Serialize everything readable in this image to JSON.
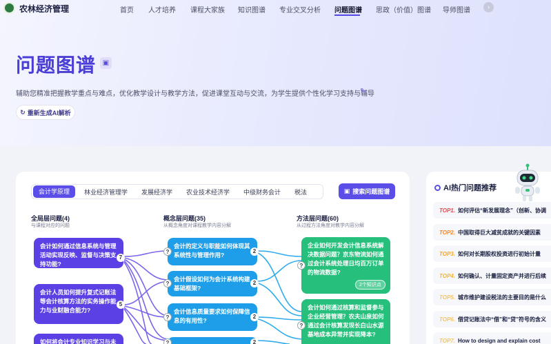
{
  "app": {
    "brand": "农林经济管理"
  },
  "nav": {
    "items": [
      "首页",
      "人才培养",
      "课程大家族",
      "知识图谱",
      "专业交叉分析",
      "问题图谱",
      "思政（价值）图谱",
      "导师图谱"
    ],
    "active": "问题图谱",
    "more_icon": "›"
  },
  "hero": {
    "title": "问题图谱",
    "subtitle": "辅助您精准把握教学重点与难点，优化教学设计与教学方法，促进课堂互动与交流，为学生提供个性化学习支持与辅导",
    "regen_label": "重新生成AI解析"
  },
  "tabs": {
    "items": [
      "会计学原理",
      "林业经济管理学",
      "发展经济学",
      "农业技术经济学",
      "中级财务会计",
      "税法"
    ],
    "active": "会计学原理",
    "more": "›"
  },
  "search_button": "搜索问题图谱",
  "columns": [
    {
      "title": "全局层问题(4)",
      "sub": "与课程对应的问题"
    },
    {
      "title": "概念层问题(35)",
      "sub": "从概念角度对课程教学内容分解"
    },
    {
      "title": "方法层问题(60)",
      "sub": "从过程方法角度对教学内容分解"
    }
  ],
  "global_nodes": [
    {
      "text": "会计如何通过信息系统与管理活动实现反映、监督与决策支持功能?",
      "count": "7"
    },
    {
      "text": "会计人员如何提升复式记账法等会计核算方法的实务操作能力与业财融合能力?",
      "count": "5"
    },
    {
      "text": "如何将会计专业知识学习与未",
      "count": ""
    }
  ],
  "concept_nodes": [
    {
      "text": "会计的定义与职能如何体现其系统性与管理作用?",
      "count": "2"
    },
    {
      "text": "会计假设如何为会计系统构建基础框架?",
      "count": "2"
    },
    {
      "text": "会计信息质量要求如何保障信息的有用性?",
      "count": "2"
    },
    {
      "text": "",
      "count": ""
    }
  ],
  "method_nodes": [
    {
      "text": "企业如何开发会计信息系统解决数据问题？京东物流如何通过会计系统处理日均百万订单的物流数据?",
      "badge": "2个知识点"
    },
    {
      "text": "会计如何通过核算和监督参与企业经营管理？农夫山泉如何通过会计核算发现长白山水源基地成本异常并实现降本?",
      "badge": ""
    }
  ],
  "hot": {
    "title": "AI热门问题推荐",
    "items": [
      {
        "rank": "TOP1.",
        "text": "如何评估“新发展理念”（创新、协调"
      },
      {
        "rank": "TOP2.",
        "text": "中国取得巨大减贫成就的关键因素"
      },
      {
        "rank": "TOP3.",
        "text": "如何对长期股权投资进行初始计量"
      },
      {
        "rank": "TOP4.",
        "text": "如何确认、计量固定资产并进行后续"
      },
      {
        "rank": "TOP5.",
        "text": "城市维护建设税法的主要目的是什么"
      },
      {
        "rank": "TOP6.",
        "text": "借贷记账法中“借”和“贷”符号的含义"
      },
      {
        "rank": "TOP7.",
        "text": "How to design and explain cost"
      }
    ],
    "rank_colors": [
      "#e5484d",
      "#f5841f",
      "#f5a623",
      "#f0b43c",
      "#f2c66b",
      "#f2c66b",
      "#f2c66b"
    ]
  },
  "colors": {
    "accent": "#5b4ee8",
    "purple_node": "#5b40e6",
    "blue_node": "#1e9ee8",
    "green_node": "#26c07c"
  }
}
